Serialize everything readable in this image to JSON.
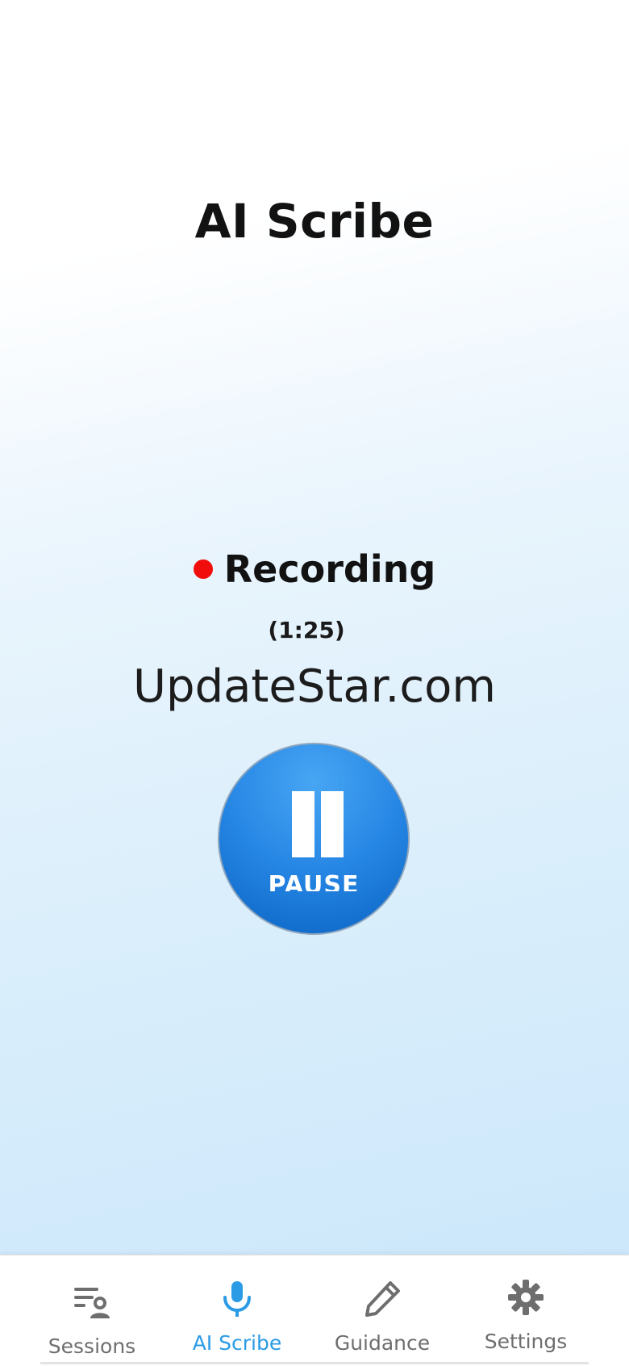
{
  "header": {
    "title": "AI Scribe"
  },
  "recording": {
    "status_label": "Recording",
    "timer": "(1:25)",
    "indicator_color": "#f20d0d"
  },
  "watermark": {
    "text": "UpdateStar.com"
  },
  "pause_button": {
    "label": "PAUSE",
    "icon": "pause-icon",
    "color": "#1f7fe0"
  },
  "tabbar": {
    "active_color": "#2b9be6",
    "inactive_color": "#6e6e6e",
    "tabs": [
      {
        "label": "Sessions",
        "icon": "sessions-list-icon",
        "active": false
      },
      {
        "label": "AI Scribe",
        "icon": "microphone-icon",
        "active": true
      },
      {
        "label": "Guidance",
        "icon": "pencil-icon",
        "active": false
      },
      {
        "label": "Settings",
        "icon": "gear-icon",
        "active": false
      }
    ]
  }
}
